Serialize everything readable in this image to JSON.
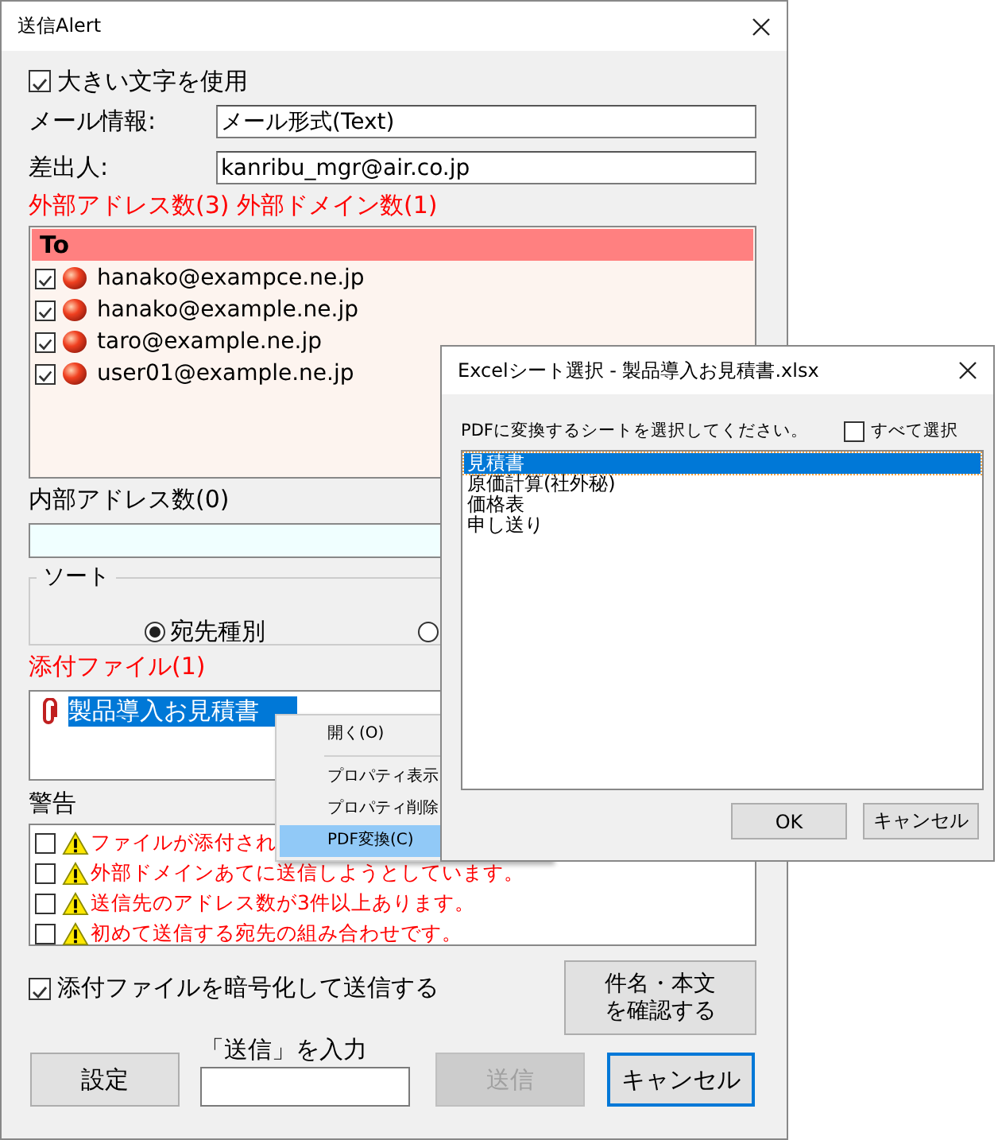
{
  "main_window": {
    "title": "送信Alert",
    "large_text": {
      "label": "大きい文字を使用",
      "checked": true
    },
    "mail_info": {
      "label": "メール情報:",
      "value": "メール形式(Text)"
    },
    "sender": {
      "label": "差出人:",
      "value": "kanribu_mgr@air.co.jp"
    },
    "external_label": "外部アドレス数(3) 外部ドメイン数(1)",
    "to_list": {
      "header": "To",
      "rows": [
        {
          "address": "hanako@exampce.ne.jp",
          "checked": true
        },
        {
          "address": "hanako@example.ne.jp",
          "checked": true
        },
        {
          "address": "taro@example.ne.jp",
          "checked": true
        },
        {
          "address": "user01@example.ne.jp",
          "checked": true
        }
      ]
    },
    "internal_label": "内部アドレス数(0)",
    "sort": {
      "title": "ソート",
      "options": [
        {
          "label": "宛先種別",
          "selected": true
        },
        {
          "selected": false
        }
      ]
    },
    "attachments_label": "添付ファイル(1)",
    "attachments": [
      {
        "name": "製品導入お見積書",
        "selected": true
      }
    ],
    "warnings_label": "警告",
    "warnings": [
      {
        "text": "ファイルが添付され",
        "checked": false
      },
      {
        "text": "外部ドメインあてに送信しようとしています。",
        "checked": false
      },
      {
        "text": "送信先のアドレス数が3件以上あります。",
        "checked": false
      },
      {
        "text": "初めて送信する宛先の組み合わせです。",
        "checked": false
      }
    ],
    "encrypt": {
      "label": "添付ファイルを暗号化して送信する",
      "checked": true
    },
    "confirm_button": "件名・本文を確認する",
    "settings_button": "設定",
    "send_input": {
      "label": "「送信」を入力"
    },
    "send_button": {
      "label": "送信",
      "disabled": true
    },
    "cancel_button": {
      "label": "キャンセル",
      "focused": true
    }
  },
  "context_menu": {
    "items": [
      {
        "label": "開く(O)",
        "selected": false
      },
      {
        "kind": "separator"
      },
      {
        "label": "プロパティ表示",
        "selected": false
      },
      {
        "label": "プロパティ削除",
        "selected": false
      },
      {
        "label": "PDF変換(C)",
        "selected": true
      }
    ]
  },
  "sheet_dialog": {
    "title": "Excelシート選択 - 製品導入お見積書.xlsx",
    "prompt": "PDFに変換するシートを選択してください。",
    "select_all": {
      "label": "すべて選択",
      "checked": false
    },
    "sheets": [
      {
        "name": "見積書",
        "selected": true
      },
      {
        "name": "原価計算(社外秘)",
        "selected": false
      },
      {
        "name": "価格表",
        "selected": false
      },
      {
        "name": "申し送り",
        "selected": false
      }
    ],
    "buttons": [
      "OK",
      "キャンセル"
    ]
  }
}
